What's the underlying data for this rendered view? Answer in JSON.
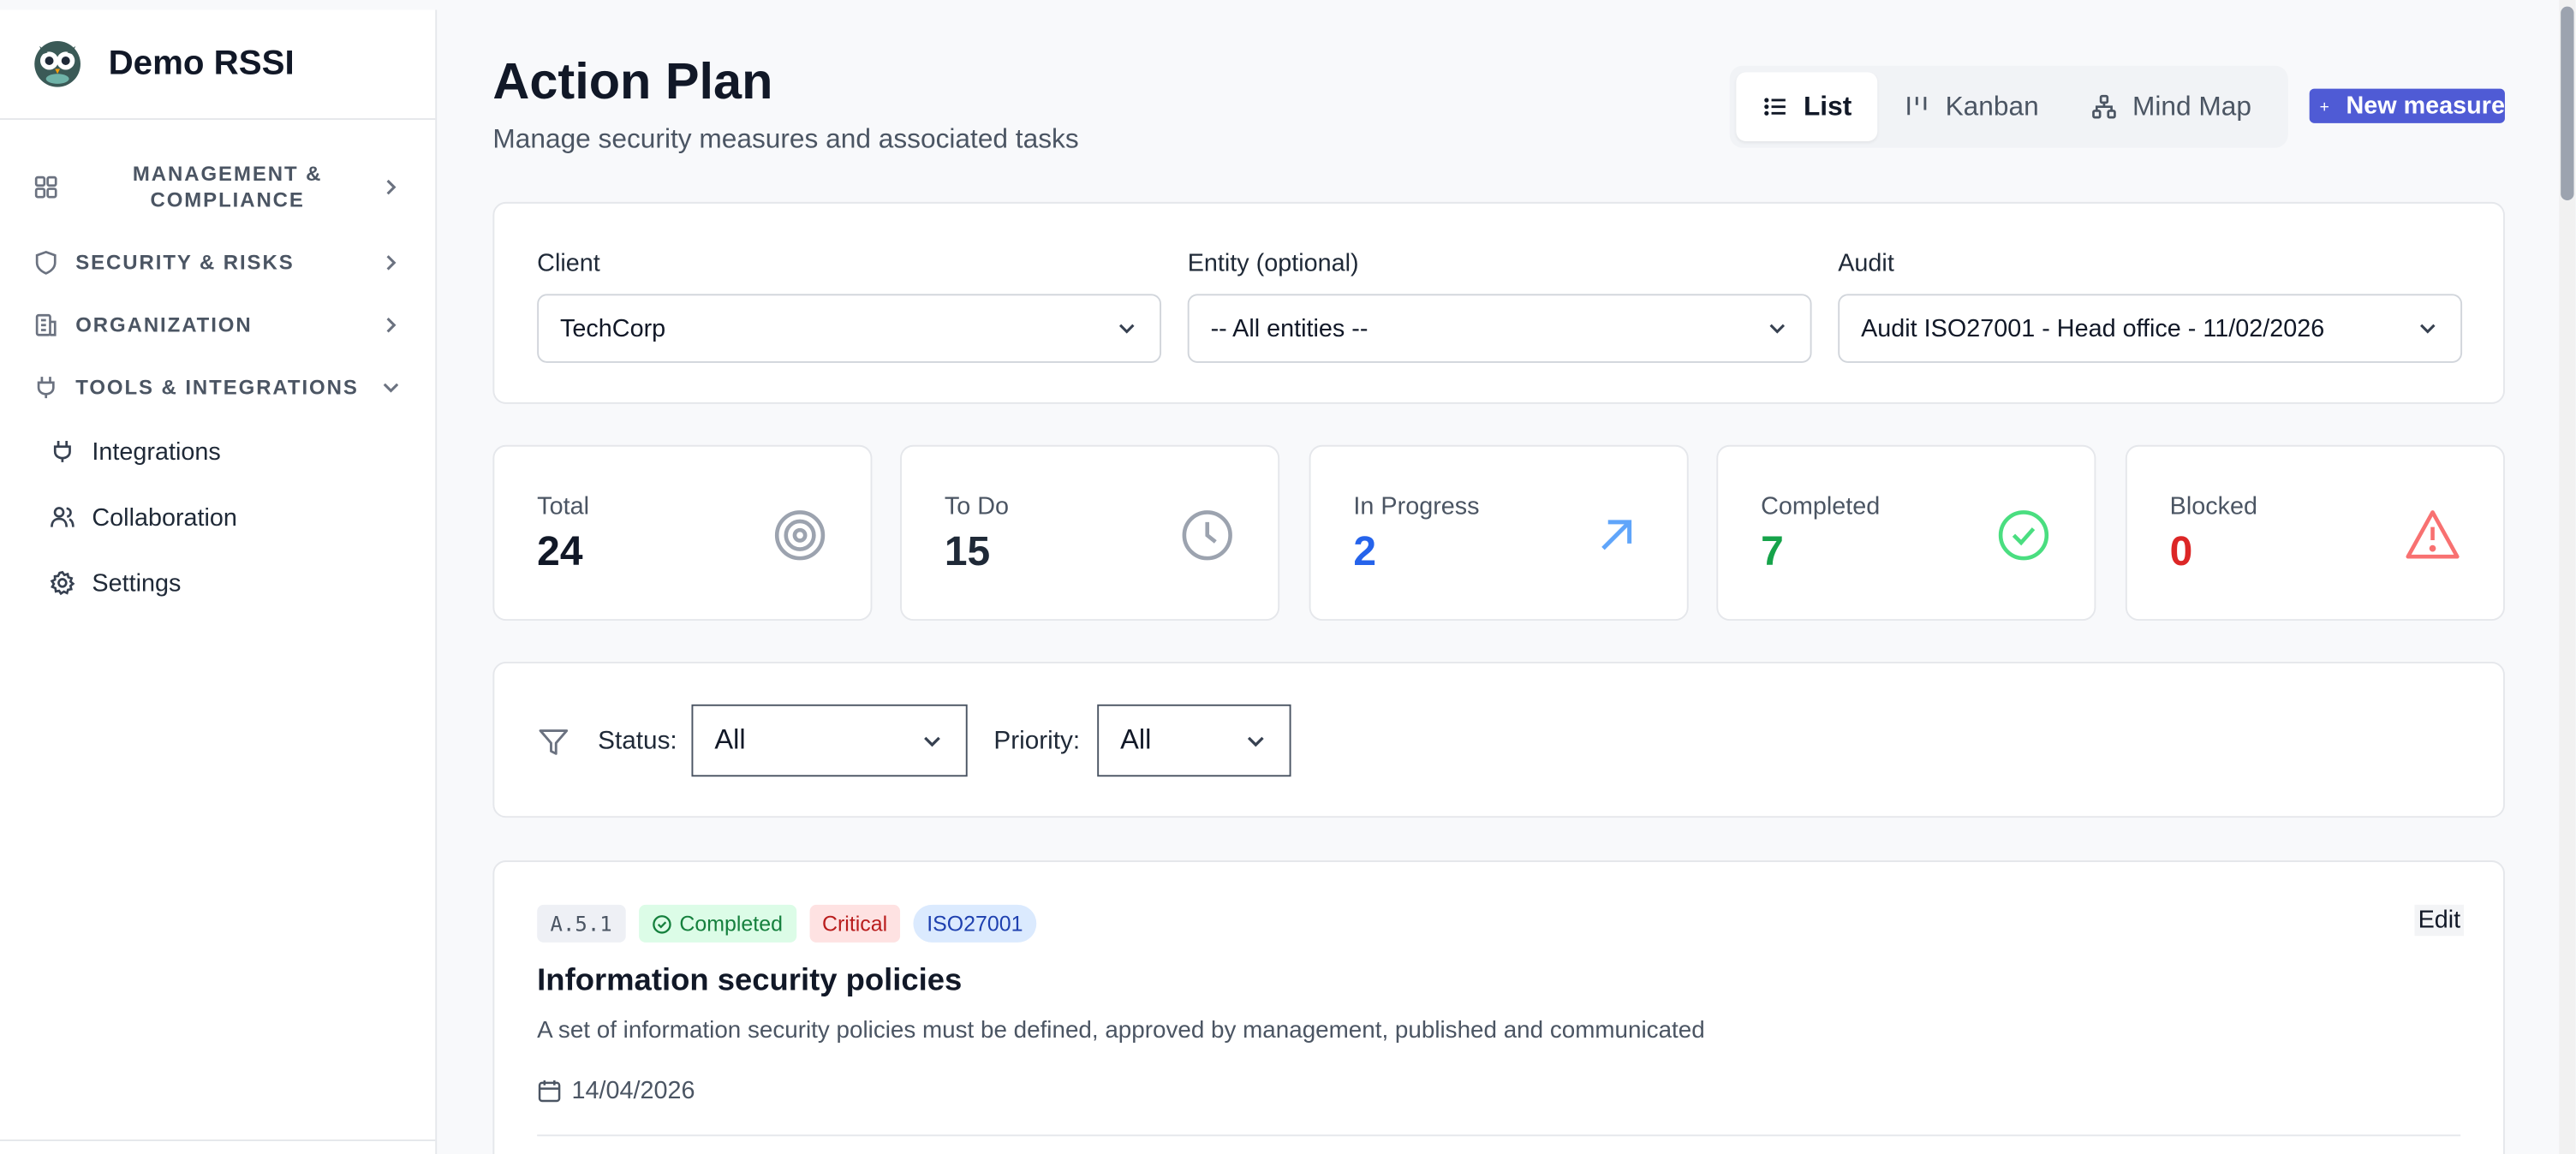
{
  "app": {
    "name": "Demo RSSI"
  },
  "sidebar": {
    "sections": [
      {
        "label": "MANAGEMENT & COMPLIANCE",
        "icon": "grid-icon",
        "expanded": false
      },
      {
        "label": "SECURITY & RISKS",
        "icon": "shield-icon",
        "expanded": false
      },
      {
        "label": "ORGANIZATION",
        "icon": "building-icon",
        "expanded": false
      },
      {
        "label": "TOOLS & INTEGRATIONS",
        "icon": "plug-icon",
        "expanded": true
      }
    ],
    "items": [
      {
        "label": "Integrations",
        "icon": "plug-icon"
      },
      {
        "label": "Collaboration",
        "icon": "users-icon"
      },
      {
        "label": "Settings",
        "icon": "gear-icon"
      }
    ]
  },
  "header": {
    "title": "Action Plan",
    "subtitle": "Manage security measures and associated tasks",
    "views": [
      {
        "label": "List",
        "active": true
      },
      {
        "label": "Kanban",
        "active": false
      },
      {
        "label": "Mind Map",
        "active": false
      }
    ],
    "new_button": "New measure"
  },
  "filters": {
    "client": {
      "label": "Client",
      "value": "TechCorp"
    },
    "entity": {
      "label": "Entity (optional)",
      "value": "-- All entities --"
    },
    "audit": {
      "label": "Audit",
      "value": "Audit ISO27001 - Head office - 11/02/2026"
    }
  },
  "stats": [
    {
      "label": "Total",
      "value": "24",
      "color": "#111827",
      "icon": "target-icon"
    },
    {
      "label": "To Do",
      "value": "15",
      "color": "#1f2937",
      "icon": "clock-icon"
    },
    {
      "label": "In Progress",
      "value": "2",
      "color": "#2563eb",
      "icon": "arrow-up-right-icon"
    },
    {
      "label": "Completed",
      "value": "7",
      "color": "#16a34a",
      "icon": "check-circle-icon"
    },
    {
      "label": "Blocked",
      "value": "0",
      "color": "#dc2626",
      "icon": "warning-icon"
    }
  ],
  "filter_bar": {
    "status_label": "Status:",
    "status_value": "All",
    "priority_label": "Priority:",
    "priority_value": "All"
  },
  "measures": [
    {
      "code": "A.5.1",
      "status": "Completed",
      "priority": "Critical",
      "framework": "ISO27001",
      "title": "Information security policies",
      "description": "A set of information security policies must be defined, approved by management, published and communicated",
      "date": "14/04/2026",
      "edit_label": "Edit"
    }
  ]
}
